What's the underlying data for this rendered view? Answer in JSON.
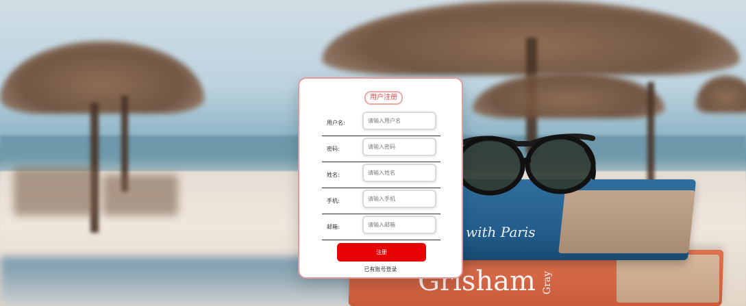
{
  "register": {
    "title": "用户注册",
    "fields": [
      {
        "label": "用户名:",
        "placeholder": "请输入用户名"
      },
      {
        "label": "密码:",
        "placeholder": "请输入密码"
      },
      {
        "label": "姓名:",
        "placeholder": "请输入姓名"
      },
      {
        "label": "手机:",
        "placeholder": "请输入手机"
      },
      {
        "label": "邮箱:",
        "placeholder": "请输入邮箱"
      }
    ],
    "submit_label": "注册",
    "login_link": "已有账号登录"
  },
  "background": {
    "book_blue_text": "with Paris",
    "book_orange_text": "Grisham",
    "book_orange_spine_text": "Gray"
  },
  "colors": {
    "accent": "#f00000",
    "title_text": "#e74949",
    "card_border": "#e79a9a"
  }
}
